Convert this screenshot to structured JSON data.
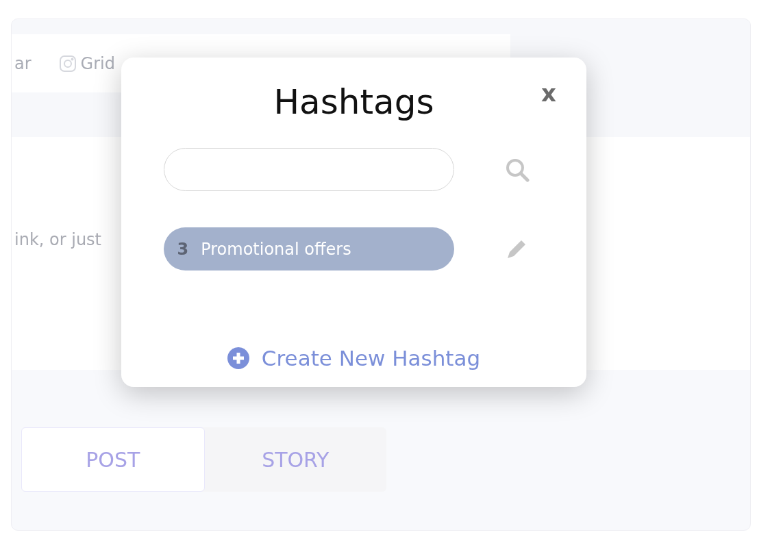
{
  "background": {
    "tabs": [
      {
        "kind": "plain",
        "label": "ar"
      },
      {
        "kind": "icon",
        "label": "Grid"
      }
    ],
    "hint": "ink, or just",
    "post_types": [
      {
        "label": "POST",
        "selected": true
      },
      {
        "label": "STORY",
        "selected": false
      }
    ]
  },
  "modal": {
    "title": "Hashtags",
    "close": "x",
    "hashtags": [
      {
        "count": "3",
        "label": "Promotional offers"
      }
    ],
    "create": "Create New Hashtag"
  }
}
